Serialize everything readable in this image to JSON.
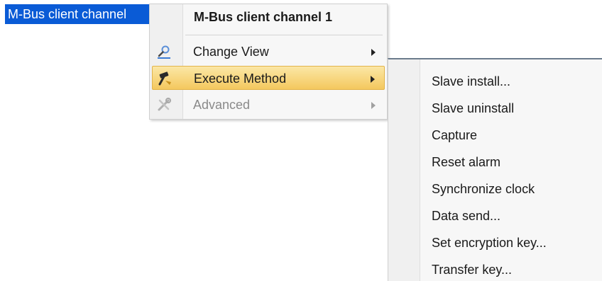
{
  "tree": {
    "selected_node": "M-Bus client channel"
  },
  "context_menu": {
    "header": "M-Bus client channel 1",
    "items": [
      {
        "label": "Change View",
        "icon": "magnifier-icon",
        "has_submenu": true,
        "state": "normal"
      },
      {
        "label": "Execute Method",
        "icon": "hammer-icon",
        "has_submenu": true,
        "state": "highlighted"
      },
      {
        "label": "Advanced",
        "icon": "tools-icon",
        "has_submenu": true,
        "state": "disabled"
      }
    ]
  },
  "submenu": {
    "items": [
      "Slave install...",
      "Slave uninstall",
      "Capture",
      "Reset alarm",
      "Synchronize clock",
      "Data send...",
      "Set encryption key...",
      "Transfer key..."
    ]
  },
  "colors": {
    "selection": "#0a5bd6",
    "highlight_top": "#fbe7a6",
    "highlight_bottom": "#f4c85e",
    "menu_bg": "#f7f7f7"
  }
}
